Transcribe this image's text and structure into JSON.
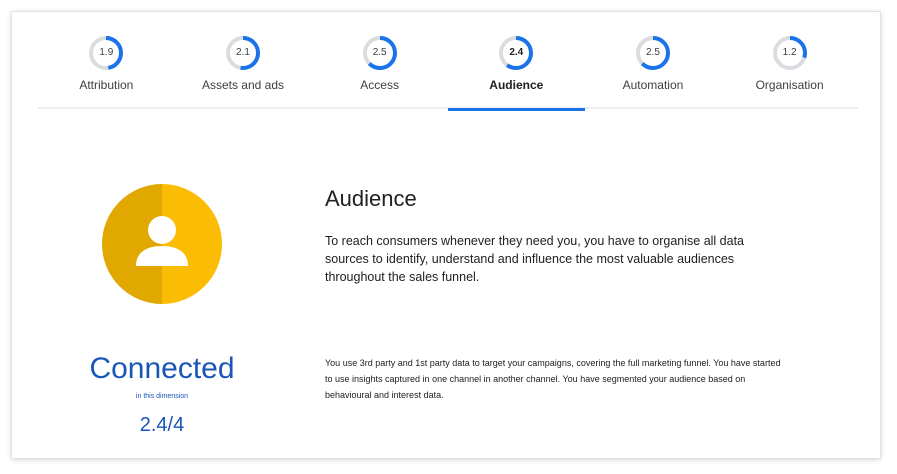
{
  "tabs": [
    {
      "label": "Attribution",
      "score": "1.9",
      "max": 4,
      "active": false
    },
    {
      "label": "Assets and ads",
      "score": "2.1",
      "max": 4,
      "active": false
    },
    {
      "label": "Access",
      "score": "2.5",
      "max": 4,
      "active": false
    },
    {
      "label": "Audience",
      "score": "2.4",
      "max": 4,
      "active": true
    },
    {
      "label": "Automation",
      "score": "2.5",
      "max": 4,
      "active": false
    },
    {
      "label": "Organisation",
      "score": "1.2",
      "max": 4,
      "active": false
    }
  ],
  "colors": {
    "ring_active": "#1a73e8",
    "ring_track": "#dadce0",
    "icon_dark": "#e0a800",
    "icon_light": "#fbbc04",
    "accent_text": "#1a56b8"
  },
  "icon": {
    "name": "person-icon"
  },
  "section": {
    "title": "Audience",
    "description": "To reach consumers whenever they need you, you have to organise all data sources to identify, understand and influence the most valuable audiences throughout the sales funnel."
  },
  "level": {
    "title": "Connected",
    "subtitle": "in this dimension",
    "score": "2.4/4",
    "description": "You use 3rd party and 1st party data to target your campaigns, covering the full marketing funnel. You have started to use insights captured in one channel in another channel. You have segmented your audience based on behavioural and interest data."
  }
}
